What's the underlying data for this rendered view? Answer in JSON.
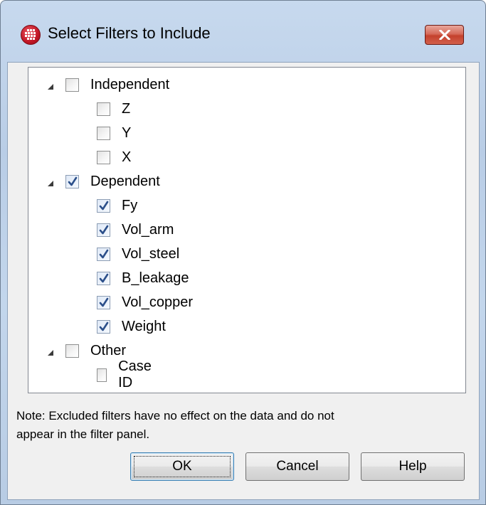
{
  "dialog": {
    "title": "Select Filters to Include",
    "close_icon": "close-icon",
    "app_icon": "app-grid-icon"
  },
  "tree": {
    "groups": [
      {
        "label": "Independent",
        "checked": false,
        "expanded": true,
        "items": [
          {
            "label": "Z",
            "checked": false
          },
          {
            "label": "Y",
            "checked": false
          },
          {
            "label": "X",
            "checked": false
          }
        ]
      },
      {
        "label": "Dependent",
        "checked": true,
        "expanded": true,
        "items": [
          {
            "label": "Fy",
            "checked": true
          },
          {
            "label": "Vol_arm",
            "checked": true
          },
          {
            "label": "Vol_steel",
            "checked": true
          },
          {
            "label": "B_leakage",
            "checked": true
          },
          {
            "label": "Vol_copper",
            "checked": true
          },
          {
            "label": "Weight",
            "checked": true
          }
        ]
      },
      {
        "label": "Other",
        "checked": false,
        "expanded": true,
        "items": [
          {
            "label": "Case ID",
            "checked": false
          }
        ]
      }
    ]
  },
  "note": {
    "line1": "Note: Excluded filters have no effect on the data and do not",
    "line2": "appear in the filter panel."
  },
  "buttons": {
    "ok": "OK",
    "cancel": "Cancel",
    "help": "Help"
  },
  "colors": {
    "check_mark": "#2b4f8a",
    "close_button": "#c4412d",
    "title_bar": "#c3d6ec"
  }
}
